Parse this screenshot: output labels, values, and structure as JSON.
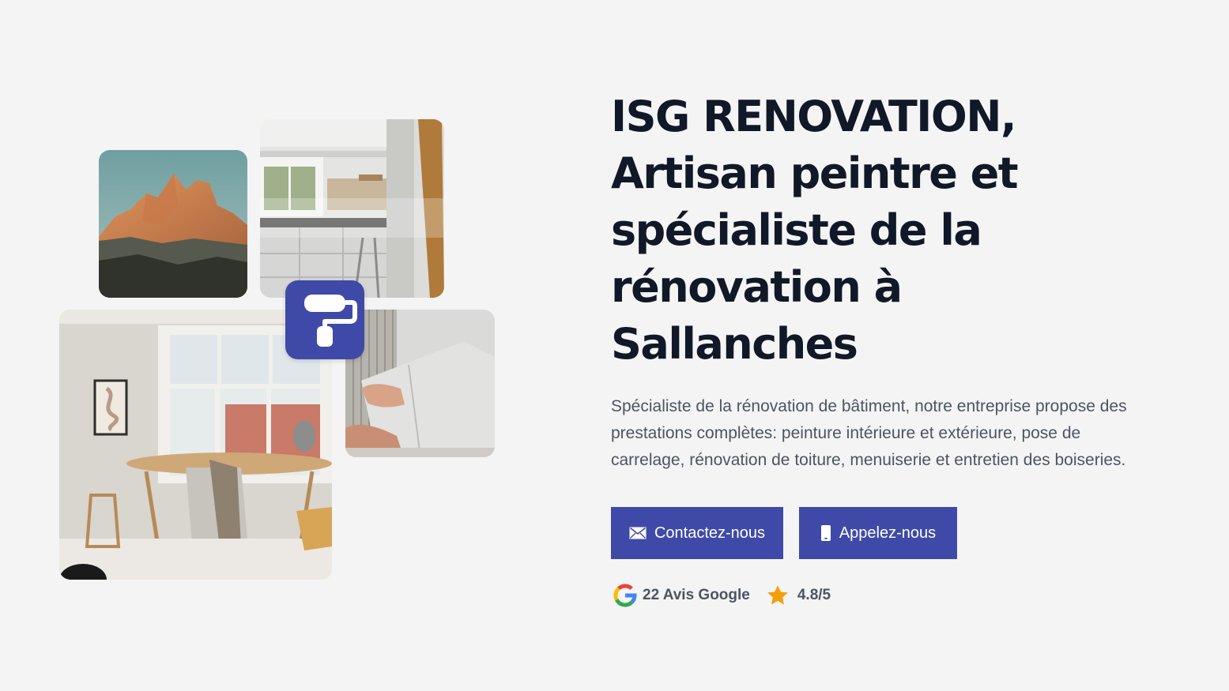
{
  "hero": {
    "title_lines": [
      "ISG RENOVATION,",
      "Artisan peintre et",
      "spécialiste de la",
      "rénovation à",
      "Sallanches"
    ],
    "description": "Spécialiste de la rénovation de bâtiment, notre entreprise propose des prestations complètes: peinture intérieure et extérieure, pose de carrelage, rénovation de toiture, menuiserie et entretien des boiseries."
  },
  "buttons": {
    "contact": {
      "label": "Contactez-nous",
      "icon": "envelope-icon"
    },
    "call": {
      "label": "Appelez-nous",
      "icon": "phone-icon"
    }
  },
  "reviews": {
    "google_count": "22 Avis Google",
    "rating": "4.8/5",
    "google_icon": "google-icon",
    "star_icon": "star-icon"
  },
  "colors": {
    "background": "#f4f4f4",
    "brand": "#3f4aa8",
    "heading": "#111827",
    "body_text": "#4b5563",
    "star": "#f59e0b"
  },
  "gallery": {
    "logo_icon": "paint-roller-icon"
  }
}
